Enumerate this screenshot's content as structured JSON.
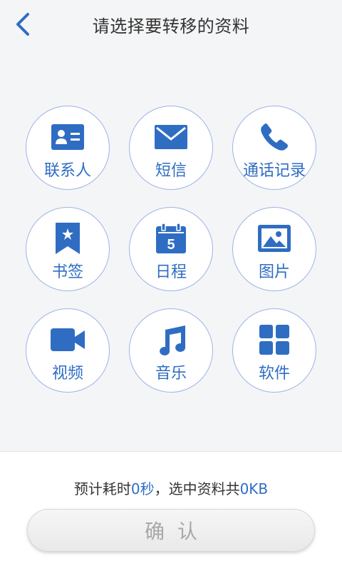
{
  "header": {
    "title": "请选择要转移的资料"
  },
  "items": [
    {
      "label": "联系人",
      "icon": "contact-card-icon"
    },
    {
      "label": "短信",
      "icon": "envelope-icon"
    },
    {
      "label": "通话记录",
      "icon": "phone-icon"
    },
    {
      "label": "书签",
      "icon": "bookmark-icon"
    },
    {
      "label": "日程",
      "icon": "calendar-icon",
      "calendar_day": "5"
    },
    {
      "label": "图片",
      "icon": "picture-icon"
    },
    {
      "label": "视频",
      "icon": "video-camera-icon"
    },
    {
      "label": "音乐",
      "icon": "music-note-icon"
    },
    {
      "label": "软件",
      "icon": "apps-grid-icon"
    }
  ],
  "summary": {
    "prefix": "预计耗时",
    "time_value": "0秒",
    "middle": "，选中资料共",
    "size_value": "0KB"
  },
  "confirm_label": "确认",
  "colors": {
    "accent": "#2f6dc3",
    "circle_border": "#9cb4e6",
    "background": "#f4f5f7"
  }
}
